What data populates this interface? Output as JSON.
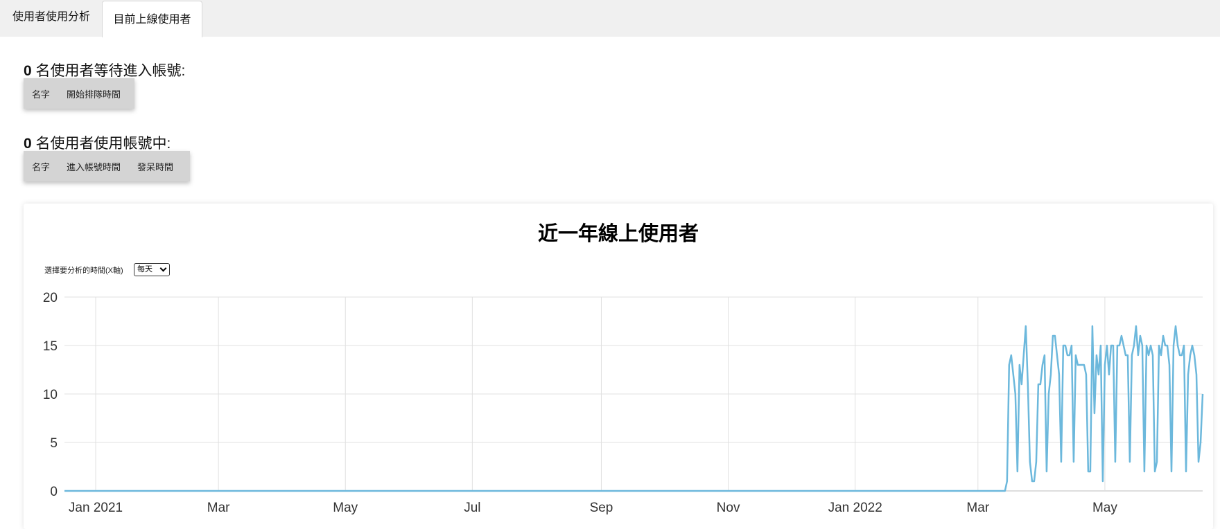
{
  "tabs": [
    {
      "label": "使用者使用分析",
      "active": false
    },
    {
      "label": "目前上線使用者",
      "active": true
    }
  ],
  "waiting": {
    "count": "0",
    "label": " 名使用者等待進入帳號:",
    "columns": [
      "名字",
      "開始排隊時間"
    ]
  },
  "using": {
    "count": "0",
    "label": " 名使用者使用帳號中:",
    "columns": [
      "名字",
      "進入帳號時間",
      "發呆時間"
    ]
  },
  "chart": {
    "title": "近一年線上使用者",
    "x_selector_label": "選擇要分析的時間(X軸)",
    "x_selector_value": "每天",
    "line_color": "#6cb8dc"
  },
  "chart_data": {
    "type": "line",
    "title": "近一年線上使用者",
    "xlabel": "",
    "ylabel": "",
    "ylim": [
      0,
      20
    ],
    "yticks": [
      0,
      5,
      10,
      15,
      20
    ],
    "x_start": "2020-12-17",
    "x_end": "2022-06-17",
    "xtick_labels": [
      {
        "label": "Jan 2021",
        "date": "2021-01-01"
      },
      {
        "label": "Mar",
        "date": "2021-03-01"
      },
      {
        "label": "May",
        "date": "2021-05-01"
      },
      {
        "label": "Jul",
        "date": "2021-07-01"
      },
      {
        "label": "Sep",
        "date": "2021-09-01"
      },
      {
        "label": "Nov",
        "date": "2021-11-01"
      },
      {
        "label": "Jan 2022",
        "date": "2022-01-01"
      },
      {
        "label": "Mar",
        "date": "2022-03-01"
      },
      {
        "label": "May",
        "date": "2022-05-01"
      }
    ],
    "grid": true,
    "series": [
      {
        "zero_until": "2022-03-14",
        "points": [
          [
            "2022-03-15",
            1
          ],
          [
            "2022-03-16",
            13
          ],
          [
            "2022-03-17",
            14
          ],
          [
            "2022-03-18",
            12
          ],
          [
            "2022-03-19",
            10
          ],
          [
            "2022-03-20",
            2
          ],
          [
            "2022-03-21",
            13
          ],
          [
            "2022-03-22",
            11
          ],
          [
            "2022-03-23",
            14
          ],
          [
            "2022-03-24",
            17
          ],
          [
            "2022-03-25",
            11
          ],
          [
            "2022-03-26",
            3
          ],
          [
            "2022-03-27",
            1
          ],
          [
            "2022-03-28",
            1
          ],
          [
            "2022-03-29",
            3
          ],
          [
            "2022-03-30",
            11
          ],
          [
            "2022-03-31",
            11
          ],
          [
            "2022-04-01",
            13
          ],
          [
            "2022-04-02",
            14
          ],
          [
            "2022-04-03",
            2
          ],
          [
            "2022-04-04",
            10
          ],
          [
            "2022-04-05",
            12
          ],
          [
            "2022-04-06",
            16
          ],
          [
            "2022-04-07",
            16
          ],
          [
            "2022-04-08",
            14
          ],
          [
            "2022-04-09",
            12
          ],
          [
            "2022-04-10",
            3
          ],
          [
            "2022-04-11",
            15
          ],
          [
            "2022-04-12",
            15
          ],
          [
            "2022-04-13",
            14
          ],
          [
            "2022-04-14",
            14
          ],
          [
            "2022-04-15",
            15
          ],
          [
            "2022-04-16",
            3
          ],
          [
            "2022-04-17",
            14
          ],
          [
            "2022-04-18",
            13
          ],
          [
            "2022-04-19",
            13
          ],
          [
            "2022-04-20",
            13
          ],
          [
            "2022-04-21",
            13
          ],
          [
            "2022-04-22",
            12
          ],
          [
            "2022-04-23",
            2
          ],
          [
            "2022-04-24",
            2
          ],
          [
            "2022-04-25",
            17
          ],
          [
            "2022-04-26",
            8
          ],
          [
            "2022-04-27",
            14
          ],
          [
            "2022-04-28",
            12
          ],
          [
            "2022-04-29",
            15
          ],
          [
            "2022-04-30",
            1
          ],
          [
            "2022-05-01",
            13
          ],
          [
            "2022-05-02",
            15
          ],
          [
            "2022-05-03",
            12
          ],
          [
            "2022-05-04",
            15
          ],
          [
            "2022-05-05",
            15
          ],
          [
            "2022-05-06",
            3
          ],
          [
            "2022-05-07",
            15
          ],
          [
            "2022-05-08",
            15
          ],
          [
            "2022-05-09",
            16
          ],
          [
            "2022-05-10",
            15
          ],
          [
            "2022-05-11",
            14
          ],
          [
            "2022-05-12",
            14
          ],
          [
            "2022-05-13",
            3
          ],
          [
            "2022-05-14",
            14
          ],
          [
            "2022-05-15",
            15
          ],
          [
            "2022-05-16",
            17
          ],
          [
            "2022-05-17",
            14
          ],
          [
            "2022-05-18",
            16
          ],
          [
            "2022-05-19",
            15
          ],
          [
            "2022-05-20",
            2
          ],
          [
            "2022-05-21",
            15
          ],
          [
            "2022-05-22",
            14
          ],
          [
            "2022-05-23",
            15
          ],
          [
            "2022-05-24",
            14
          ],
          [
            "2022-05-25",
            2
          ],
          [
            "2022-05-26",
            3
          ],
          [
            "2022-05-27",
            15
          ],
          [
            "2022-05-28",
            14
          ],
          [
            "2022-05-29",
            16
          ],
          [
            "2022-05-30",
            15
          ],
          [
            "2022-05-31",
            15
          ],
          [
            "2022-06-01",
            13
          ],
          [
            "2022-06-02",
            2
          ],
          [
            "2022-06-03",
            15
          ],
          [
            "2022-06-04",
            17
          ],
          [
            "2022-06-05",
            15
          ],
          [
            "2022-06-06",
            14
          ],
          [
            "2022-06-07",
            14
          ],
          [
            "2022-06-08",
            15
          ],
          [
            "2022-06-09",
            2
          ],
          [
            "2022-06-10",
            12
          ],
          [
            "2022-06-11",
            14
          ],
          [
            "2022-06-12",
            15
          ],
          [
            "2022-06-13",
            14
          ],
          [
            "2022-06-14",
            12
          ],
          [
            "2022-06-15",
            3
          ],
          [
            "2022-06-16",
            5
          ],
          [
            "2022-06-17",
            10
          ]
        ]
      }
    ]
  }
}
